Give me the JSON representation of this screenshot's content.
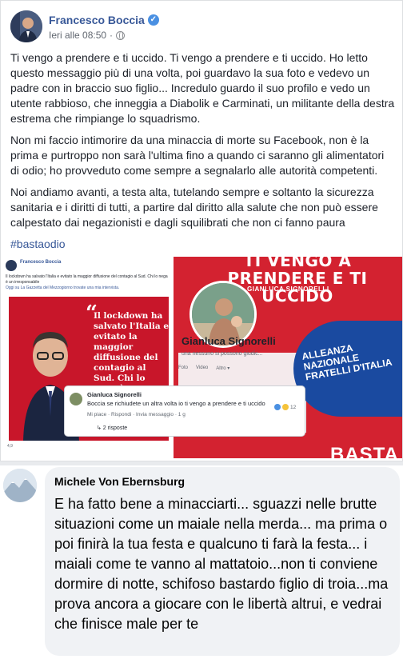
{
  "post": {
    "author": "Francesco Boccia",
    "timestamp": "Ieri alle 08:50",
    "separator": "·",
    "paragraphs": [
      "Ti vengo a prendere e ti uccido. Ti vengo a prendere e ti uccido. Ho letto questo messaggio più di una volta, poi guardavo la sua foto e vedevo un padre con in braccio suo figlio... Incredulo guardo il suo profilo e vedo un utente rabbioso, che inneggia a Diabolik e Carminati, un militante della destra estrema che rimpiange lo squadrismo.",
      "Non mi faccio intimorire da una minaccia di morte su Facebook, non è la prima e purtroppo non sarà l'ultima fino a quando ci saranno gli alimentatori di odio; ho provveduto come sempre a segnalarlo alle autorità competenti.",
      "Noi andiamo avanti, a testa alta, tutelando sempre e soltanto la sicurezza sanitaria e i diritti di tutti, a partire dal diritto alla salute che non può essere calpestato dai negazionisti e dagli squilibrati che non ci fanno paura"
    ],
    "hashtag": "#bastaodio",
    "verified_icon": "check-badge-icon",
    "privacy_icon": "globe-icon"
  },
  "media": {
    "mini_author": "Francesco Boccia",
    "mini_text": "Il lockdown ha salvato l'Italia e evitato la maggior diffusione del contagio al Sud. Chi lo nega è un irresponsabile",
    "mini_link": "Oggi su La Gazzetta del Mezzogiorno trovate una mia intervista.",
    "quote": "Il lockdown ha salvato l'Italia e evitato la maggior diffusione del contagio al Sud. Chi lo nega è un irresponsabile",
    "mini_reacts": "4,9",
    "headline": "TI VENGO A PRENDERE E TI UCCIDO",
    "headline_name": "GIANLUCA SIGNORELLI",
    "profile_name": "Gianluca Signorelli",
    "profile_sub": "una nessuno si possono giudic...",
    "profile_tabs": [
      "Foto",
      "Video",
      "Altro ▾"
    ],
    "party_text": "ALLEANZA NAZIONALE FRATELLI D'ITALIA",
    "bottom_word": "BASTA",
    "comment": {
      "name": "Gianluca Signorelli",
      "text": "Boccia se richiudete un altra volta io ti vengo a prendere e ti uccido",
      "actions": "Mi piace · Rispondi · Invia messaggio · 1 g",
      "replies": "↳ 2 risposte",
      "react_count": "12"
    }
  },
  "second_comment": {
    "name": "Michele Von Ebernsburg",
    "text": "E ha fatto bene a minacciarti... sguazzi nelle brutte situazioni come un maiale nella merda... ma prima o poi finirà la tua festa e qualcuno ti farà la festa... i maiali come te vanno al mattatoio...non ti conviene dormire di notte, schifoso bastardo figlio di troia...ma prova ancora a giocare con le libertà altrui, e vedrai che finisce male per te"
  }
}
